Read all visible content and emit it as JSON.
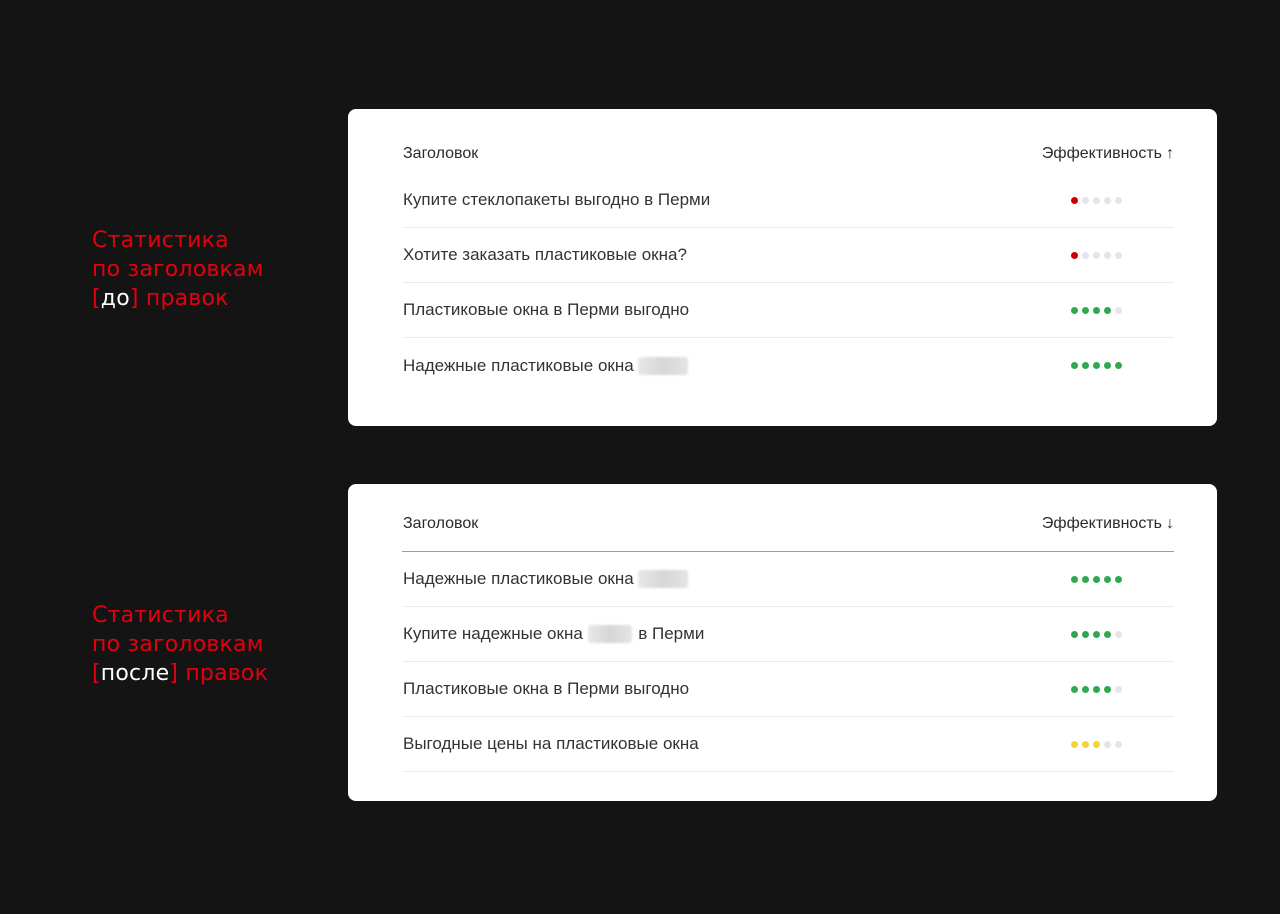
{
  "captions": [
    {
      "line1": "Статистика",
      "line2": "по заголовкам",
      "bracket_open": "[",
      "highlight": "до",
      "bracket_close": "]",
      "tail": " правок"
    },
    {
      "line1": "Статистика",
      "line2": "по заголовкам",
      "bracket_open": "[",
      "highlight": "после",
      "bracket_close": "]",
      "tail": " правок"
    }
  ],
  "tables": [
    {
      "col_title": "Заголовок",
      "col_efficiency": "Эффективность",
      "sort_icon": "arrow-up-icon",
      "sort_glyph": "↑",
      "rows": [
        {
          "parts": [
            "Купите стеклопакеты выгодно в Перми"
          ],
          "rating": 1,
          "color": "#cc0000"
        },
        {
          "parts": [
            "Хотите заказать пластиковые окна?"
          ],
          "rating": 1,
          "color": "#cc0000"
        },
        {
          "parts": [
            "Пластиковые окна в Перми выгодно"
          ],
          "rating": 4,
          "color": "#2fa84f"
        },
        {
          "parts": [
            "Надежные пластиковые окна "
          ],
          "redacted": true,
          "rating": 5,
          "color": "#2fa84f"
        }
      ]
    },
    {
      "col_title": "Заголовок",
      "col_efficiency": "Эффективность",
      "sort_icon": "arrow-down-icon",
      "sort_glyph": "↓",
      "rows": [
        {
          "parts": [
            "Надежные пластиковые окна "
          ],
          "redacted": true,
          "rating": 5,
          "color": "#2fa84f"
        },
        {
          "parts": [
            "Купите надежные окна ",
            " в Перми"
          ],
          "redacted_middle": true,
          "rating": 4,
          "color": "#2fa84f"
        },
        {
          "parts": [
            "Пластиковые окна в Перми выгодно"
          ],
          "rating": 4,
          "color": "#2fa84f"
        },
        {
          "parts": [
            "Выгодные цены на пластиковые окна"
          ],
          "rating": 3,
          "color": "#f2d43a"
        }
      ]
    }
  ]
}
